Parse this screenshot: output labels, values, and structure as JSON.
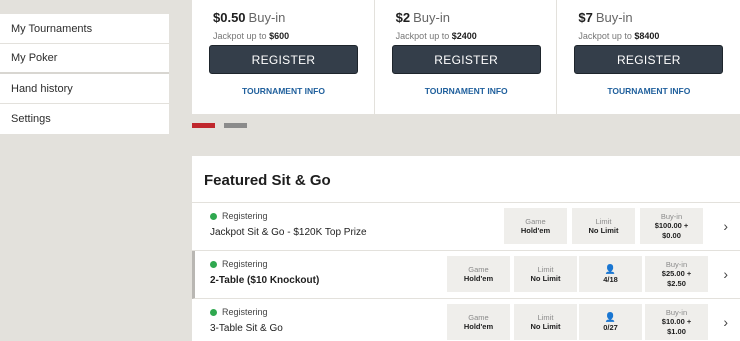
{
  "sidebar": {
    "items": [
      {
        "label": "My Tournaments"
      },
      {
        "label": "My Poker"
      },
      {
        "label": "Hand history"
      },
      {
        "label": "Settings"
      }
    ]
  },
  "cards": [
    {
      "price": "$0.50",
      "buyin_word": "Buy-in",
      "jackpot_text": "Jackpot up to",
      "jackpot_amount": "$600",
      "register": "REGISTER",
      "info": "TOURNAMENT INFO"
    },
    {
      "price": "$2",
      "buyin_word": "Buy-in",
      "jackpot_text": "Jackpot up to",
      "jackpot_amount": "$2400",
      "register": "REGISTER",
      "info": "TOURNAMENT INFO"
    },
    {
      "price": "$7",
      "buyin_word": "Buy-in",
      "jackpot_text": "Jackpot up to",
      "jackpot_amount": "$8400",
      "register": "REGISTER",
      "info": "TOURNAMENT INFO"
    }
  ],
  "carousel": {
    "active_page": 1,
    "pages": 2
  },
  "featured": {
    "title": "Featured Sit & Go",
    "rows": [
      {
        "status": "Registering",
        "name": "Jackpot Sit & Go - $120K Top Prize",
        "game_label": "Game",
        "game": "Hold'em",
        "limit_label": "Limit",
        "limit": "No Limit",
        "players": "",
        "buyin_label": "Buy-in",
        "buyin1": "$100.00 +",
        "buyin2": "$0.00"
      },
      {
        "status": "Registering",
        "name": "2-Table ($10 Knockout)",
        "game_label": "Game",
        "game": "Hold'em",
        "limit_label": "Limit",
        "limit": "No Limit",
        "players": "4/18",
        "buyin_label": "Buy-in",
        "buyin1": "$25.00 +",
        "buyin2": "$2.50"
      },
      {
        "status": "Registering",
        "name": "3-Table Sit & Go",
        "game_label": "Game",
        "game": "Hold'em",
        "limit_label": "Limit",
        "limit": "No Limit",
        "players": "0/27",
        "buyin_label": "Buy-in",
        "buyin1": "$10.00 +",
        "buyin2": "$1.00"
      }
    ]
  },
  "icons": {
    "status": "green-dot-icon",
    "user": "user-icon",
    "chevron": "chevron-right-icon"
  },
  "colors": {
    "register_bg": "#343e4a",
    "link": "#1f5f9c",
    "pager_active": "#c0272d",
    "status_green": "#2fa84f"
  }
}
